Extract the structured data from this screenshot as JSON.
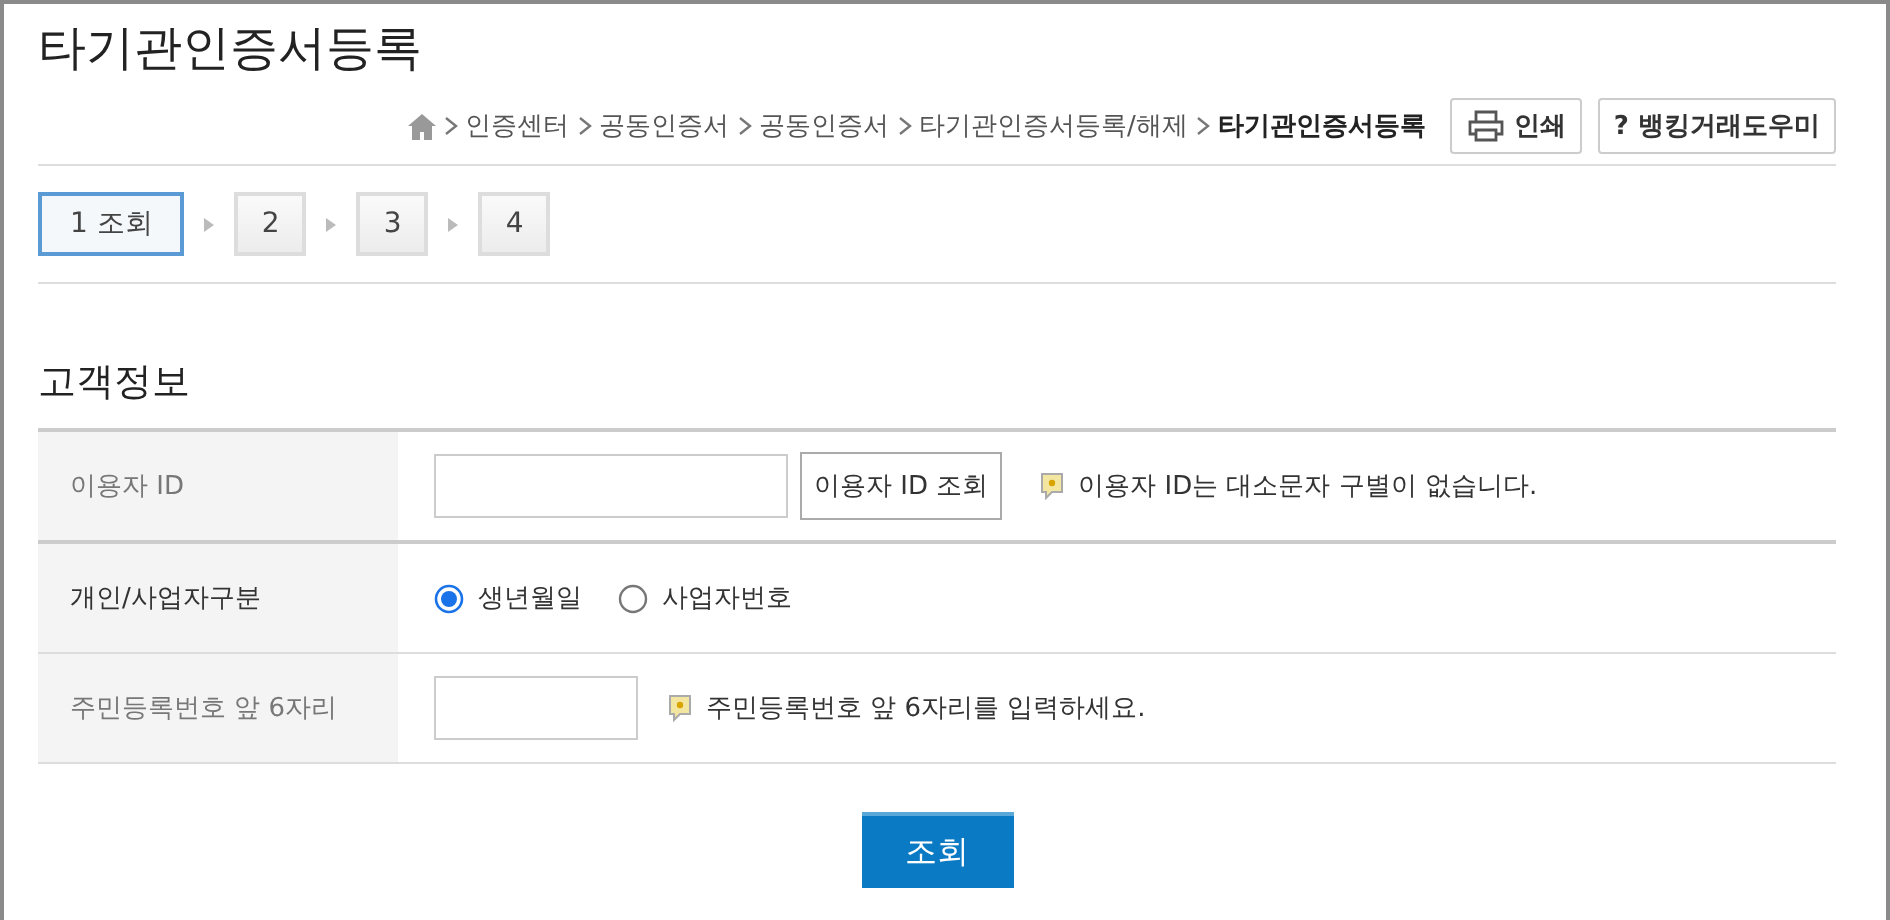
{
  "title": "타기관인증서등록",
  "breadcrumb": {
    "items": [
      "인증센터",
      "공동인증서",
      "공동인증서",
      "타기관인증서등록/해제"
    ],
    "current": "타기관인증서등록"
  },
  "toolbar": [
    {
      "kind": "print",
      "label": "인쇄"
    },
    {
      "kind": "help",
      "label": "? 뱅킹거래도우미"
    }
  ],
  "steps": [
    {
      "label": "1 조회",
      "selected": true
    },
    {
      "label": "2",
      "selected": false
    },
    {
      "label": "3",
      "selected": false
    },
    {
      "label": "4",
      "selected": false
    }
  ],
  "section_title": "고객정보",
  "form": [
    {
      "kind": "lookup",
      "label": "이용자 ID",
      "button": "이용자 ID 조회",
      "hint": "이용자 ID는 대소문자 구별이 없습니다."
    },
    {
      "kind": "radio",
      "label": "개인/사업자구분",
      "options": [
        {
          "label": "생년월일",
          "selected": true
        },
        {
          "label": "사업자번호",
          "selected": false
        }
      ]
    },
    {
      "kind": "short",
      "label": "주민등록번호 앞 6자리",
      "hint": "주민등록번호 앞 6자리를 입력하세요."
    }
  ],
  "submit": "조회"
}
